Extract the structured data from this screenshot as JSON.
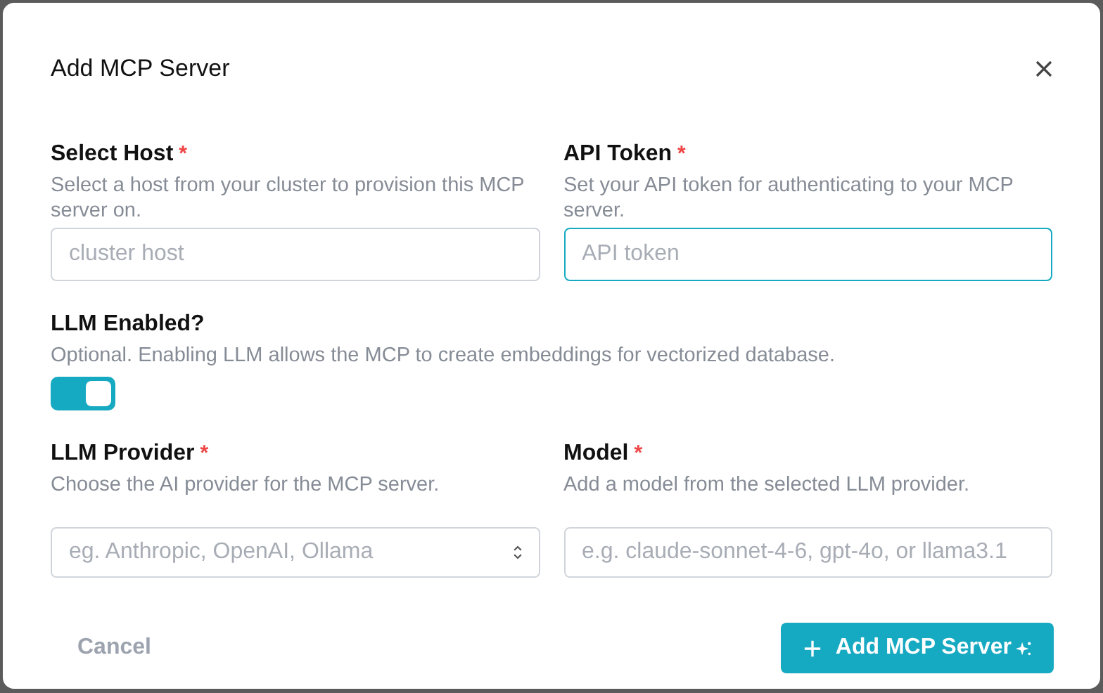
{
  "dialog": {
    "title": "Add MCP Server",
    "rows": [
      {
        "fields": [
          {
            "label": "Select Host",
            "required_mark": "*",
            "help": "Select a host from your cluster to provision this MCP server on.",
            "kind": "text",
            "placeholder": "cluster host",
            "focused": false
          },
          {
            "label": "API Token",
            "required_mark": "*",
            "help": "Set your API token for authenticating to your MCP server.",
            "kind": "text",
            "placeholder": "API token",
            "focused": true
          }
        ]
      },
      {
        "fields": [
          {
            "label": "LLM Enabled?",
            "help": "Optional. Enabling LLM allows the MCP to create embeddings for vectorized database.",
            "kind": "toggle",
            "on": true
          }
        ]
      },
      {
        "fields": [
          {
            "label": "LLM Provider",
            "required_mark": "*",
            "help": "Choose the AI provider for the MCP server.",
            "kind": "select",
            "placeholder": "eg. Anthropic, OpenAI, Ollama",
            "focused": false
          },
          {
            "label": "Model",
            "required_mark": "*",
            "help": "Add a model from the selected LLM provider.",
            "kind": "text",
            "placeholder": "e.g. claude-sonnet-4-6, gpt-4o, or llama3.1",
            "focused": false
          }
        ]
      }
    ],
    "cancel_button": "Cancel",
    "submit_button": "Add MCP Server"
  }
}
